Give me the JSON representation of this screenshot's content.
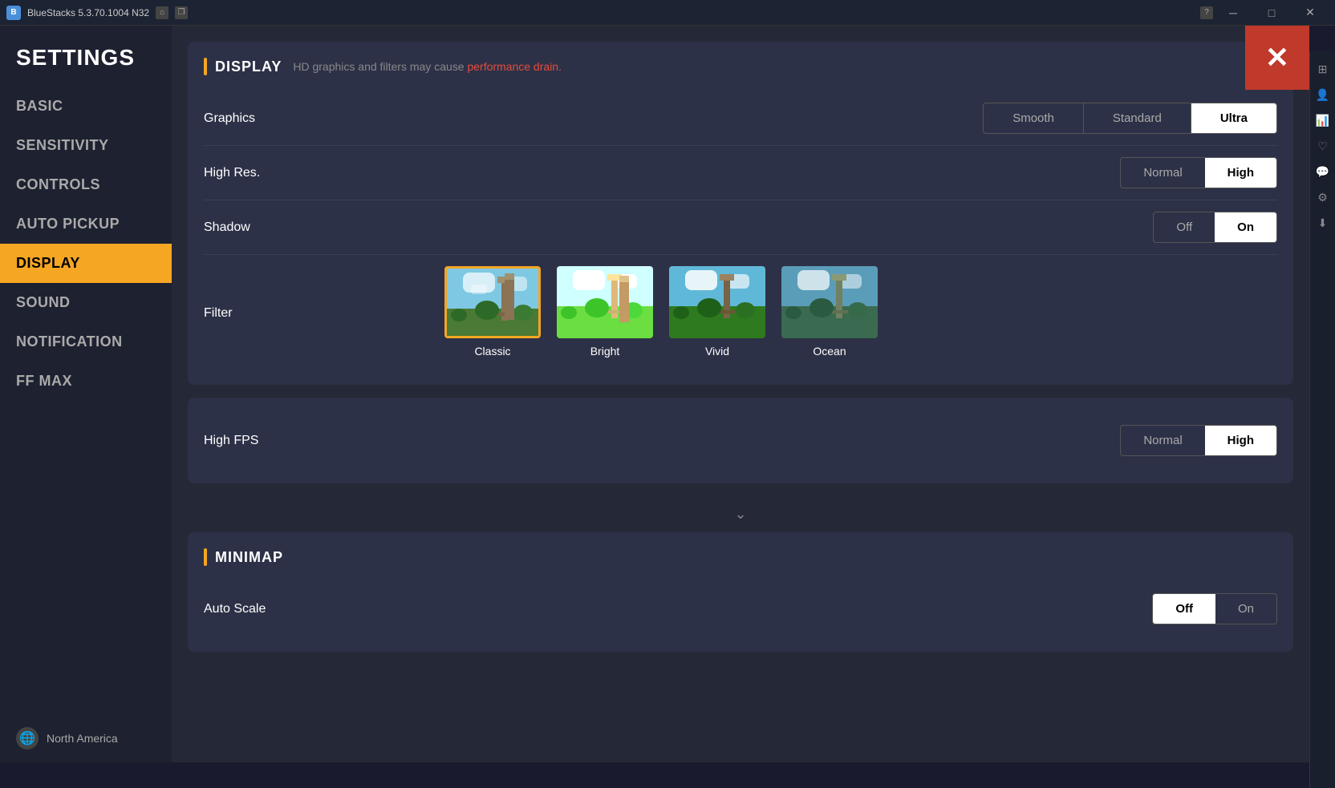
{
  "titlebar": {
    "app_name": "BlueStacks 5.3.70.1004 N32",
    "home_icon": "⌂",
    "copy_icon": "❐",
    "help_icon": "?",
    "menu_icon": "☰",
    "minimize_icon": "─",
    "maximize_icon": "□",
    "close_icon": "✕"
  },
  "sidebar": {
    "title": "SETTINGS",
    "items": [
      {
        "label": "BASIC",
        "active": false
      },
      {
        "label": "SENSITIVITY",
        "active": false
      },
      {
        "label": "CONTROLS",
        "active": false
      },
      {
        "label": "AUTO PICKUP",
        "active": false
      },
      {
        "label": "DISPLAY",
        "active": true
      },
      {
        "label": "SOUND",
        "active": false
      },
      {
        "label": "NOTIFICATION",
        "active": false
      },
      {
        "label": "FF MAX",
        "active": false
      }
    ],
    "footer": {
      "globe_icon": "🌐",
      "region": "North America"
    }
  },
  "close_button": "✕",
  "display_section": {
    "bar_label": "|",
    "title": "DISPLAY",
    "subtitle": "HD graphics and filters may cause ",
    "subtitle_red": "performance drain.",
    "graphics": {
      "label": "Graphics",
      "options": [
        "Smooth",
        "Standard",
        "Ultra"
      ],
      "active": "Ultra"
    },
    "high_res": {
      "label": "High Res.",
      "options": [
        "Normal",
        "High"
      ],
      "active": "High"
    },
    "shadow": {
      "label": "Shadow",
      "options": [
        "Off",
        "On"
      ],
      "active": "On"
    },
    "filter": {
      "label": "Filter",
      "options": [
        {
          "name": "Classic",
          "selected": true,
          "style": "classic"
        },
        {
          "name": "Bright",
          "selected": false,
          "style": "bright"
        },
        {
          "name": "Vivid",
          "selected": false,
          "style": "vivid"
        },
        {
          "name": "Ocean",
          "selected": false,
          "style": "ocean"
        }
      ]
    }
  },
  "high_fps_section": {
    "label": "High FPS",
    "options": [
      "Normal",
      "High"
    ],
    "active": "High"
  },
  "minimap_section": {
    "bar_label": "|",
    "title": "MINIMAP",
    "auto_scale": {
      "label": "Auto Scale",
      "options": [
        "Off",
        "On"
      ],
      "active": "Off"
    }
  },
  "right_sidebar": {
    "icons": [
      "⊞",
      "👤",
      "📊",
      "♡",
      "💬",
      "⚙",
      "⬇"
    ]
  },
  "scroll_down_icon": "⌄"
}
